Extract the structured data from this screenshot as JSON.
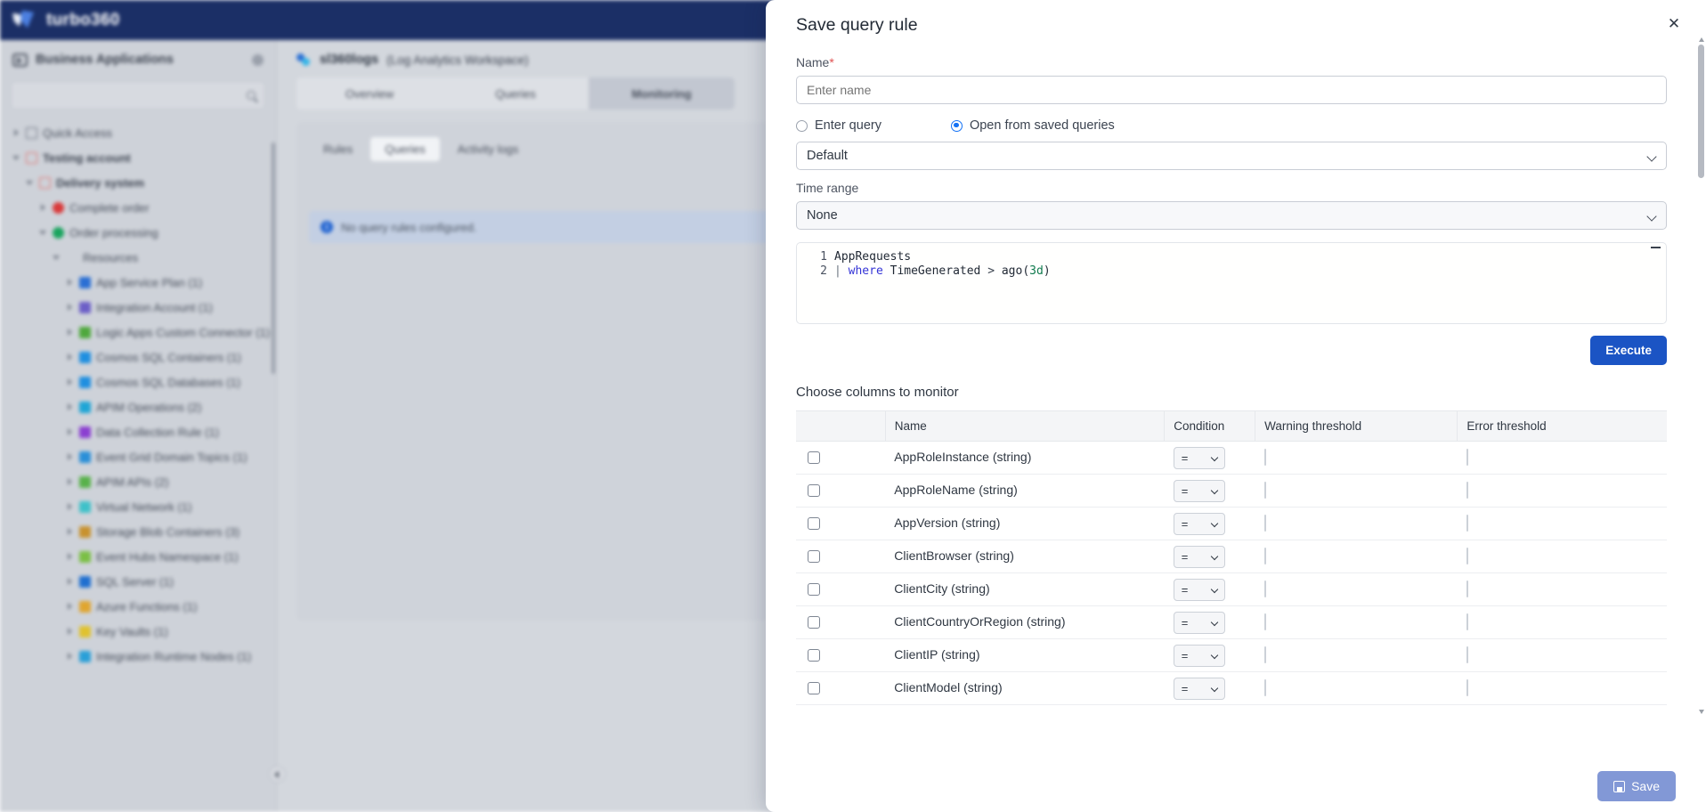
{
  "colors": {
    "brand_navy": "#1b2f66",
    "accent_blue": "#1b54c4",
    "radio_blue": "#1472f5",
    "save_disabled": "#8298d6",
    "required_red": "#e05252"
  },
  "topbar": {
    "brand": "turbo360",
    "logo_icon": "turbo360-logo-icon"
  },
  "sidebar": {
    "title": "Business Applications",
    "title_icon": "business-applications-icon",
    "settings_icon": "gear-icon",
    "search": {
      "placeholder": "",
      "value": "",
      "icon": "search-icon"
    },
    "items": [
      {
        "label": "Quick Access",
        "indent": 0,
        "caret": "right",
        "icon": "bookmark",
        "color": ""
      },
      {
        "label": "Testing account",
        "indent": 0,
        "caret": "down",
        "icon": "folder",
        "color": "#e0706d",
        "bold": true
      },
      {
        "label": "Delivery system",
        "indent": 1,
        "caret": "down",
        "icon": "folder",
        "color": "#e0706d",
        "bold": true
      },
      {
        "label": "Complete order",
        "indent": 2,
        "caret": "right",
        "icon": "dot",
        "color": "#d93b3b"
      },
      {
        "label": "Order processing",
        "indent": 2,
        "caret": "down",
        "icon": "dot",
        "color": "#19a45e"
      },
      {
        "label": "Resources",
        "indent": 3,
        "caret": "down",
        "icon": "square",
        "color": "#5aa councils"
      },
      {
        "label": "App Service Plan (1)",
        "indent": 4,
        "caret": "right",
        "icon": "square",
        "color": "#2a6fd4"
      },
      {
        "label": "Integration Account (1)",
        "indent": 4,
        "caret": "right",
        "icon": "square",
        "color": "#6c5fc7"
      },
      {
        "label": "Logic Apps Custom Connector (1)",
        "indent": 4,
        "caret": "right",
        "icon": "square",
        "color": "#4fa83d"
      },
      {
        "label": "Cosmos SQL Containers (1)",
        "indent": 4,
        "caret": "right",
        "icon": "square",
        "color": "#1f8fe0"
      },
      {
        "label": "Cosmos SQL Databases (1)",
        "indent": 4,
        "caret": "right",
        "icon": "square",
        "color": "#1f8fe0"
      },
      {
        "label": "APIM Operations (2)",
        "indent": 4,
        "caret": "right",
        "icon": "square",
        "color": "#1fa5d6"
      },
      {
        "label": "Data Collection Rule (1)",
        "indent": 4,
        "caret": "right",
        "icon": "square",
        "color": "#8b3fd1"
      },
      {
        "label": "Event Grid Domain Topics (1)",
        "indent": 4,
        "caret": "right",
        "icon": "square",
        "color": "#2a8fd8"
      },
      {
        "label": "APIM APIs (2)",
        "indent": 4,
        "caret": "right",
        "icon": "square",
        "color": "#58b14a"
      },
      {
        "label": "Virtual Network (1)",
        "indent": 4,
        "caret": "right",
        "icon": "square",
        "color": "#3fc1c9"
      },
      {
        "label": "Storage Blob Containers (3)",
        "indent": 4,
        "caret": "right",
        "icon": "square",
        "color": "#c8922f"
      },
      {
        "label": "Event Hubs Namespace (1)",
        "indent": 4,
        "caret": "right",
        "icon": "square",
        "color": "#7bbf45"
      },
      {
        "label": "SQL Server (1)",
        "indent": 4,
        "caret": "right",
        "icon": "square",
        "color": "#1f6fd0"
      },
      {
        "label": "Azure Functions (1)",
        "indent": 4,
        "caret": "right",
        "icon": "square",
        "color": "#e0a52f"
      },
      {
        "label": "Key Vaults (1)",
        "indent": 4,
        "caret": "right",
        "icon": "square",
        "color": "#e0c22f"
      },
      {
        "label": "Integration Runtime Nodes (1)",
        "indent": 4,
        "caret": "right",
        "icon": "square",
        "color": "#2a9fd8"
      }
    ]
  },
  "content": {
    "resource_icon": "log-analytics-icon",
    "resource_name": "sl360logs",
    "resource_type": "(Log Analytics Workspace)",
    "main_tabs": [
      {
        "label": "Overview",
        "active": false
      },
      {
        "label": "Queries",
        "active": false
      },
      {
        "label": "Monitoring",
        "active": true
      }
    ],
    "sub_tabs": [
      {
        "label": "Rules",
        "active": false
      },
      {
        "label": "Queries",
        "active": true
      },
      {
        "label": "Activity logs",
        "active": false
      }
    ],
    "info_icon": "info-icon",
    "info_glyph": "i",
    "info_message": "No query rules configured.",
    "collapse_icon": "collapse-panel-icon"
  },
  "modal": {
    "title": "Save query rule",
    "close_icon": "close-icon",
    "name_label": "Name",
    "name_required_mark": "*",
    "name_value": "",
    "name_placeholder": "Enter name",
    "query_source_options": [
      {
        "label": "Enter query",
        "selected": false
      },
      {
        "label": "Open from saved queries",
        "selected": true
      }
    ],
    "saved_query_value": "Default",
    "time_range_label": "Time range",
    "time_range_value": "None",
    "editor": {
      "minimize_icon": "minimize-icon",
      "lines": [
        {
          "number": "1",
          "text": "AppRequests"
        },
        {
          "number": "2",
          "text": "| where TimeGenerated > ago(3d)"
        }
      ]
    },
    "execute_label": "Execute",
    "choose_columns_label": "Choose columns to monitor",
    "table": {
      "headers": [
        "",
        "Name",
        "Condition",
        "Warning threshold",
        "Error threshold"
      ],
      "rows": [
        {
          "name": "AppRoleInstance (string)",
          "condition": "=",
          "warning": "",
          "error": "",
          "checked": false
        },
        {
          "name": "AppRoleName (string)",
          "condition": "=",
          "warning": "",
          "error": "",
          "checked": false
        },
        {
          "name": "AppVersion (string)",
          "condition": "=",
          "warning": "",
          "error": "",
          "checked": false
        },
        {
          "name": "ClientBrowser (string)",
          "condition": "=",
          "warning": "",
          "error": "",
          "checked": false
        },
        {
          "name": "ClientCity (string)",
          "condition": "=",
          "warning": "",
          "error": "",
          "checked": false
        },
        {
          "name": "ClientCountryOrRegion (string)",
          "condition": "=",
          "warning": "",
          "error": "",
          "checked": false
        },
        {
          "name": "ClientIP (string)",
          "condition": "=",
          "warning": "",
          "error": "",
          "checked": false
        },
        {
          "name": "ClientModel (string)",
          "condition": "=",
          "warning": "",
          "error": "",
          "checked": false
        }
      ]
    },
    "save_label": "Save",
    "save_icon": "floppy-disk-icon",
    "scrollbar": {
      "up_icon": "scroll-up-arrow",
      "down_icon": "scroll-down-arrow"
    }
  }
}
